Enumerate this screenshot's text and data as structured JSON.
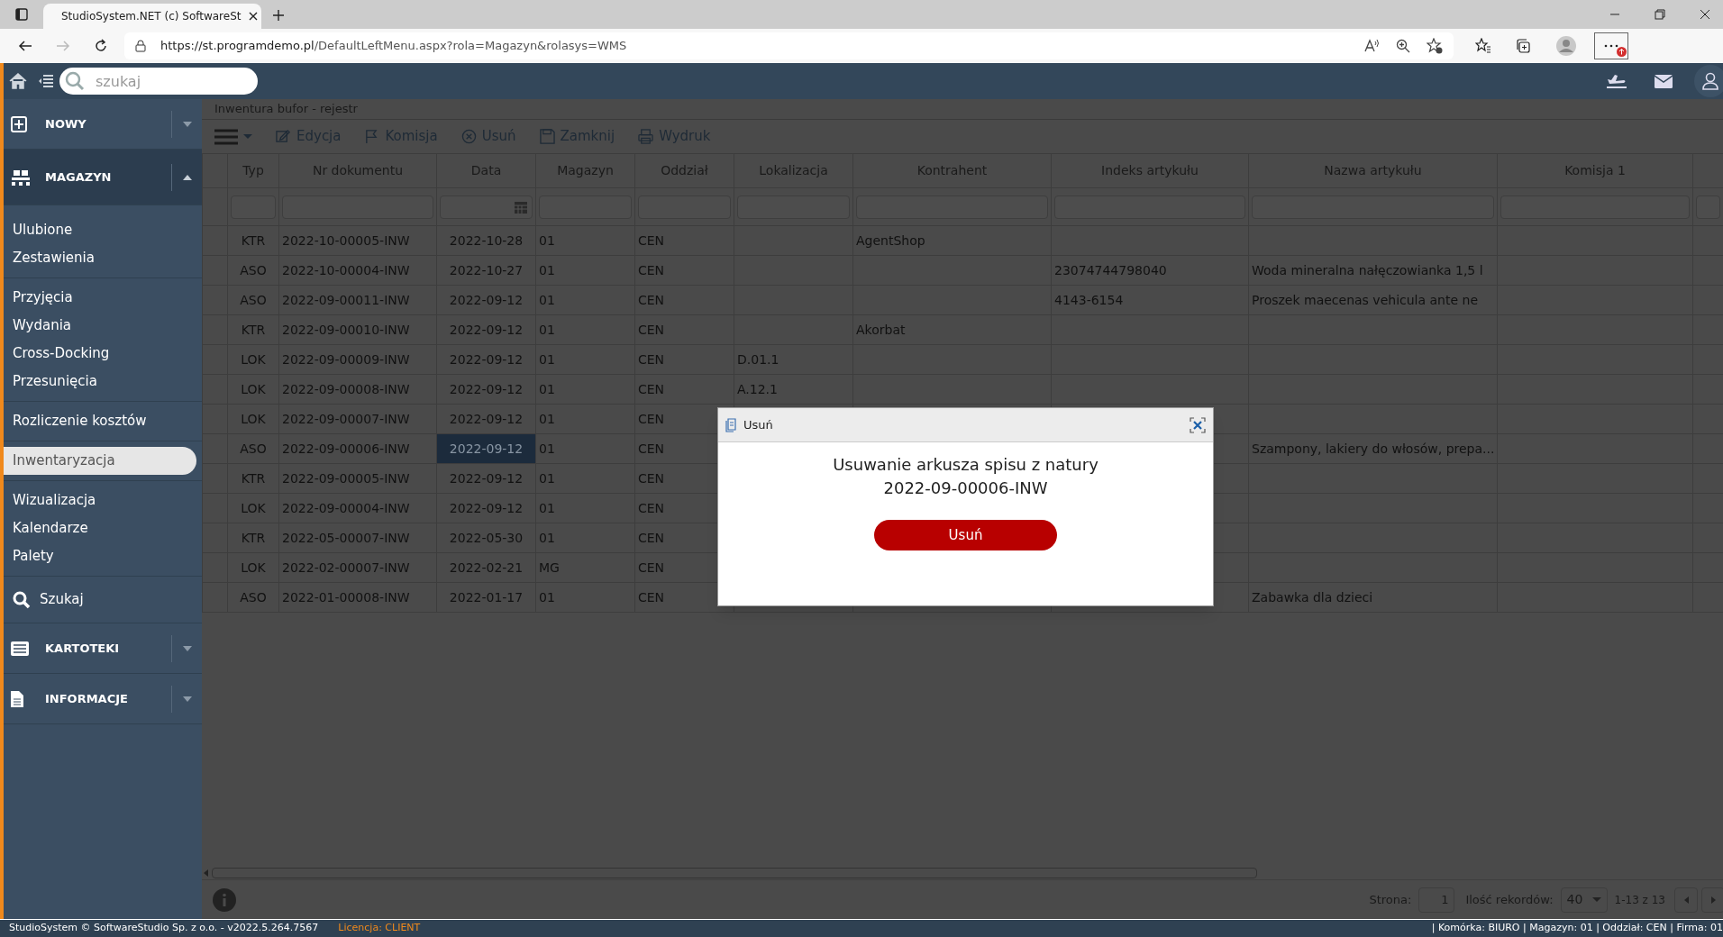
{
  "browser": {
    "tab_title": "StudioSystem.NET (c) SoftwareSt",
    "url_host": "https://st.programdemo.pl",
    "url_path": "/DefaultLeftMenu.aspx?rola=Magazyn&rolasys=WMS"
  },
  "header": {
    "search_placeholder": "szukaj"
  },
  "sidebar": [
    {
      "kind": "header",
      "label": "NOWY",
      "expanded": false
    },
    {
      "kind": "header",
      "label": "MAGAZYN",
      "expanded": true
    },
    {
      "kind": "group",
      "items": [
        {
          "label": "Ulubione",
          "selected": false
        },
        {
          "label": "Zestawienia",
          "selected": false
        }
      ]
    },
    {
      "kind": "group",
      "items": [
        {
          "label": "Przyjęcia",
          "selected": false
        },
        {
          "label": "Wydania",
          "selected": false
        },
        {
          "label": "Cross-Docking",
          "selected": false
        },
        {
          "label": "Przesunięcia",
          "selected": false
        }
      ]
    },
    {
      "kind": "group",
      "items": [
        {
          "label": "Rozliczenie kosztów",
          "selected": false
        }
      ]
    },
    {
      "kind": "group",
      "items": [
        {
          "label": "Inwentaryzacja",
          "selected": true
        }
      ]
    },
    {
      "kind": "group",
      "items": [
        {
          "label": "Wizualizacja",
          "selected": false
        },
        {
          "label": "Kalendarze",
          "selected": false
        },
        {
          "label": "Palety",
          "selected": false
        }
      ]
    },
    {
      "kind": "link",
      "label": "Szukaj"
    },
    {
      "kind": "header",
      "label": "KARTOTEKI",
      "expanded": false
    },
    {
      "kind": "header",
      "label": "INFORMACJE",
      "expanded": false
    }
  ],
  "page_title": "Inwentura bufor - rejestr",
  "toolbar": [
    "Edycja",
    "Komisja",
    "Usuń",
    "Zamknij",
    "Wydruk"
  ],
  "table": {
    "columns": [
      "Typ",
      "Nr dokumentu",
      "Data",
      "Magazyn",
      "Oddział",
      "Lokalizacja",
      "Kontrahent",
      "Indeks artykułu",
      "Nazwa artykułu",
      "Komisja 1"
    ],
    "rows": [
      {
        "selected": false,
        "cells": [
          "KTR",
          "2022-10-00005-INW",
          "2022-10-28",
          "01",
          "CEN",
          null,
          "AgentShop",
          null,
          null,
          null
        ]
      },
      {
        "selected": false,
        "cells": [
          "ASO",
          "2022-10-00004-INW",
          "2022-10-27",
          "01",
          "CEN",
          null,
          null,
          "23074744798040",
          "Woda mineralna nałęczowianka 1,5 l",
          null
        ]
      },
      {
        "selected": false,
        "cells": [
          "ASO",
          "2022-09-00011-INW",
          "2022-09-12",
          "01",
          "CEN",
          null,
          null,
          "4143-6154",
          "Proszek maecenas vehicula ante ne",
          null
        ]
      },
      {
        "selected": false,
        "cells": [
          "KTR",
          "2022-09-00010-INW",
          "2022-09-12",
          "01",
          "CEN",
          null,
          "Akorbat",
          null,
          null,
          null
        ]
      },
      {
        "selected": false,
        "cells": [
          "LOK",
          "2022-09-00009-INW",
          "2022-09-12",
          "01",
          "CEN",
          "D.01.1",
          null,
          null,
          null,
          null
        ]
      },
      {
        "selected": false,
        "cells": [
          "LOK",
          "2022-09-00008-INW",
          "2022-09-12",
          "01",
          "CEN",
          "A.12.1",
          null,
          null,
          null,
          null
        ]
      },
      {
        "selected": false,
        "cells": [
          "LOK",
          "2022-09-00007-INW",
          "2022-09-12",
          "01",
          "CEN",
          null,
          null,
          null,
          null,
          null
        ]
      },
      {
        "selected": true,
        "cells": [
          "ASO",
          "2022-09-00006-INW",
          "2022-09-12",
          "01",
          "CEN",
          null,
          null,
          null,
          "Szampony, lakiery do włosów, prepa...",
          null
        ]
      },
      {
        "selected": false,
        "cells": [
          "KTR",
          "2022-09-00005-INW",
          "2022-09-12",
          "01",
          "CEN",
          null,
          null,
          null,
          null,
          null
        ]
      },
      {
        "selected": false,
        "cells": [
          "LOK",
          "2022-09-00004-INW",
          "2022-09-12",
          "01",
          "CEN",
          null,
          null,
          null,
          null,
          null
        ]
      },
      {
        "selected": false,
        "cells": [
          "KTR",
          "2022-05-00007-INW",
          "2022-05-30",
          "01",
          "CEN",
          null,
          null,
          null,
          null,
          null
        ]
      },
      {
        "selected": false,
        "cells": [
          "LOK",
          "2022-02-00007-INW",
          "2022-02-21",
          "MG",
          "CEN",
          null,
          null,
          null,
          null,
          null
        ]
      },
      {
        "selected": false,
        "cells": [
          "ASO",
          "2022-01-00008-INW",
          "2022-01-17",
          "01",
          "CEN",
          null,
          null,
          null,
          "Zabawka dla dzieci",
          null
        ]
      }
    ]
  },
  "dialog": {
    "title": "Usuń",
    "message_lines": [
      "Usuwanie arkusza spisu z natury",
      "2022-09-00006-INW"
    ],
    "button": "Usuń"
  },
  "pager": {
    "page_label": "Strona:",
    "page": "1",
    "size_label": "Ilość rekordów:",
    "size": "40",
    "range": "1-13 z 13"
  },
  "status_bar": {
    "copyright": "StudioSystem © SoftwareStudio Sp. z o.o. - v2022.5.264.7567",
    "license_label": "Licencja:",
    "license_value": "CLIENT",
    "info": "| Komórka: BIURO | Magazyn: 01 | Oddział: CEN | Firma: 01"
  }
}
